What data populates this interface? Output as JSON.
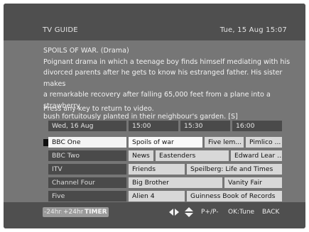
{
  "header": {
    "title": "TV GUIDE",
    "datetime": "Tue, 15 Aug 15:07"
  },
  "synopsis": {
    "heading": "SPOILS OF WAR. (Drama)",
    "lines": [
      "Poignant drama in which a teenage boy finds himself  mediating with his",
      "divorced parents after he gets to know his estranged father.   His sister makes",
      "a remarkable recovery after falling 65,000 feet from a plane into a strawberry",
      "bush fortuitously planted in their neighbour's garden. [S]"
    ]
  },
  "prompt": "Press any key to return to video.",
  "grid": {
    "date": "Wed, 16 Aug",
    "times": [
      "15:00",
      "15:30",
      "16:00"
    ],
    "channels": [
      {
        "name": "BBC One",
        "programmes": [
          "Spoils of war",
          "Five lem...",
          "Pimlico ..."
        ]
      },
      {
        "name": "BBC Two",
        "programmes": [
          "News",
          "Eastenders",
          "Edward Lear ..."
        ]
      },
      {
        "name": "ITV",
        "programmes": [
          "Friends",
          "Speilberg: Life and Times"
        ]
      },
      {
        "name": "Channel Four",
        "programmes": [
          "Big Brother",
          "Vanity Fair"
        ]
      },
      {
        "name": "Five",
        "programmes": [
          "Alien 4",
          "Guinness Book of Records"
        ]
      }
    ],
    "selected_channel": "BBC One",
    "selected_programme": "Spoils of war"
  },
  "footer": {
    "minus24": "-24hrs",
    "plus24": "+24hrs",
    "timer": "TIMER",
    "page": "P+/P-",
    "ok": "OK:Tune",
    "back": "BACK"
  },
  "colors": {
    "screen": "#767676",
    "bars": "#4f4f4f",
    "selected": "#fafafa",
    "programme": "#d8d8d8"
  }
}
